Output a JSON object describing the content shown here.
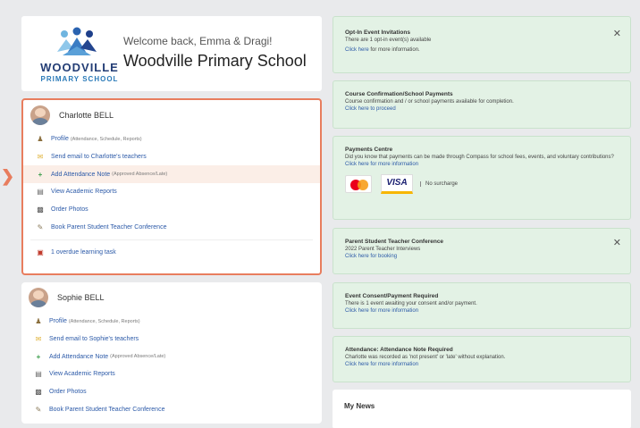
{
  "school": {
    "logo_word": "WOODVILLE",
    "logo_sub": "PRIMARY SCHOOL",
    "welcome": "Welcome back, Emma & Dragi!",
    "name": "Woodville Primary School"
  },
  "children": [
    {
      "name": "Charlotte BELL",
      "links": [
        {
          "icon": "user-icon",
          "label": "Profile",
          "sub": "(Attendance, Schedule, Reports)"
        },
        {
          "icon": "mail-icon",
          "label": "Send email to Charlotte's teachers",
          "sub": ""
        },
        {
          "icon": "plus-icon",
          "label": "Add Attendance Note",
          "sub": "(Approved Absence/Late)"
        },
        {
          "icon": "document-icon",
          "label": "View Academic Reports",
          "sub": ""
        },
        {
          "icon": "photo-icon",
          "label": "Order Photos",
          "sub": ""
        },
        {
          "icon": "book-icon",
          "label": "Book Parent Student Teacher Conference",
          "sub": ""
        }
      ],
      "task": "1 overdue learning task"
    },
    {
      "name": "Sophie BELL",
      "links": [
        {
          "icon": "user-icon",
          "label": "Profile",
          "sub": "(Attendance, Schedule, Reports)"
        },
        {
          "icon": "mail-icon",
          "label": "Send email to Sophie's teachers",
          "sub": ""
        },
        {
          "icon": "plus-icon",
          "label": "Add Attendance Note",
          "sub": "(Approved Absence/Late)"
        },
        {
          "icon": "document-icon",
          "label": "View Academic Reports",
          "sub": ""
        },
        {
          "icon": "photo-icon",
          "label": "Order Photos",
          "sub": ""
        },
        {
          "icon": "book-icon",
          "label": "Book Parent Student Teacher Conference",
          "sub": ""
        }
      ]
    }
  ],
  "notices": [
    {
      "title": "Opt-In Event Invitations",
      "body": "There are 1 opt-in event(s) available",
      "link": "Click here",
      "link_tail": " for more information.",
      "closable": true
    },
    {
      "title": "Course Confirmation/School Payments",
      "body": "Course confirmation and / or school payments available for completion.",
      "link": "Click here to proceed",
      "link_tail": "",
      "closable": false
    },
    {
      "title": "Payments Centre",
      "body": "Did you know that payments can be made through Compass for school fees, events, and voluntary contributions?",
      "link": "Click here for more information",
      "link_tail": "",
      "surcharge": "No surcharge",
      "visa": "VISA",
      "closable": false
    },
    {
      "title": "Parent Student Teacher Conference",
      "body": "2022 Parent Teacher Interviews",
      "link": "Click here for booking",
      "link_tail": "",
      "closable": true
    },
    {
      "title": "Event Consent/Payment Required",
      "body": "There is 1 event awaiting your consent and/or payment.",
      "link": "Click here for more information",
      "link_tail": "",
      "closable": false
    },
    {
      "title": "Attendance: Attendance Note Required",
      "body": "Charlotte was recorded as 'not present' or 'late' without explanation.",
      "link": "Click here for more information",
      "link_tail": "",
      "closable": false
    }
  ],
  "news": {
    "title": "My News"
  },
  "colors": {
    "accent": "#e87d5e",
    "notice_bg": "#e3f2e5",
    "link": "#2c5aa8",
    "brand": "#233d75"
  }
}
